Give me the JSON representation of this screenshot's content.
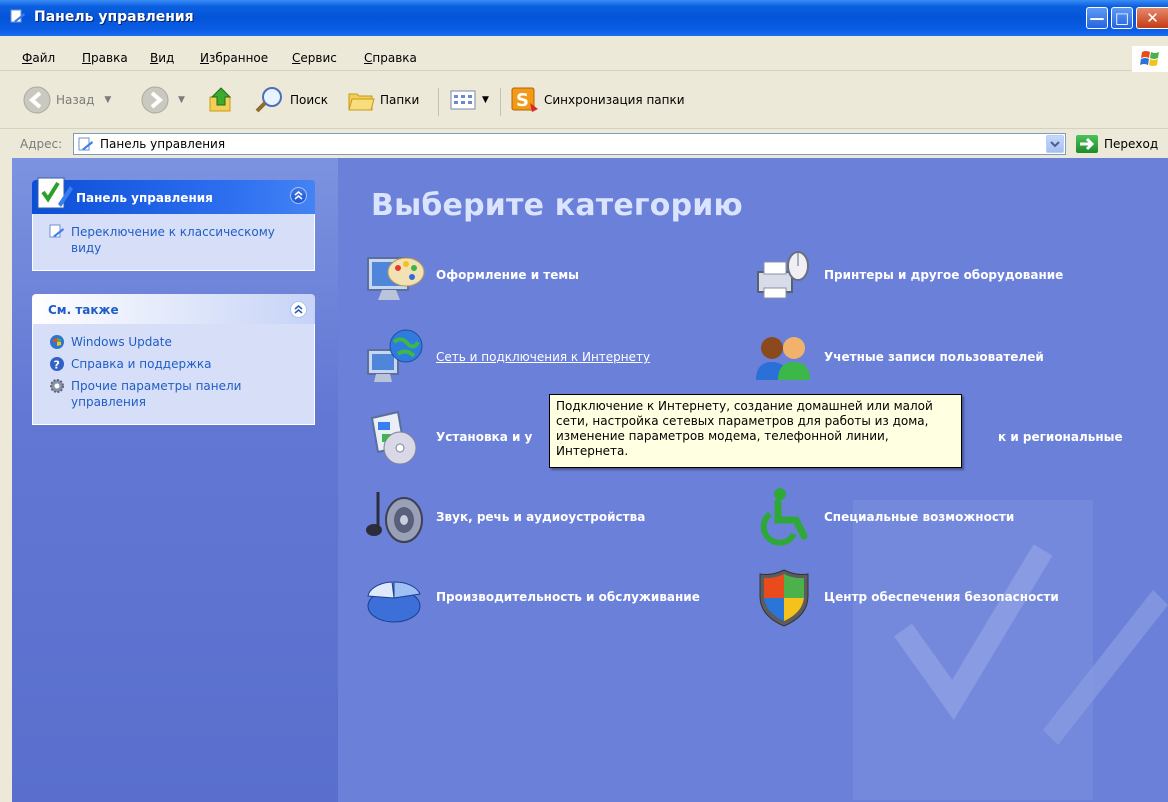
{
  "window": {
    "title": "Панель управления"
  },
  "menu": [
    "Файл",
    "Правка",
    "Вид",
    "Избранное",
    "Сервис",
    "Справка"
  ],
  "toolbar": {
    "back_label": "Назад",
    "search_label": "Поиск",
    "folders_label": "Папки",
    "sync_label": "Синхронизация папки"
  },
  "address": {
    "label": "Адрес:",
    "value": "Панель управления",
    "go_label": "Переход"
  },
  "left_panel": {
    "control_panel": {
      "title": "Панель управления",
      "items": [
        {
          "label": "Переключение к классическому виду",
          "icon": "control-panel-icon"
        }
      ]
    },
    "see_also": {
      "title": "См. также",
      "items": [
        {
          "label": "Windows Update",
          "icon": "windows-update-icon"
        },
        {
          "label": "Справка и поддержка",
          "icon": "help-icon"
        },
        {
          "label": "Прочие параметры панели управления",
          "icon": "settings-icon"
        }
      ]
    }
  },
  "main": {
    "heading": "Выберите категорию",
    "categories": [
      {
        "label": "Оформление и темы",
        "icon": "appearance-themes-icon"
      },
      {
        "label": "Принтеры и другое оборудование",
        "icon": "printers-hardware-icon"
      },
      {
        "label": "Сеть и подключения к Интернету",
        "icon": "network-internet-icon"
      },
      {
        "label": "Учетные записи пользователей",
        "icon": "user-accounts-icon"
      },
      {
        "label": "Установка и у",
        "icon": "add-remove-programs-icon"
      },
      {
        "label": "к и региональные",
        "icon": "regional-options-icon"
      },
      {
        "label": "Звук, речь и аудиоустройства",
        "icon": "sounds-speech-icon"
      },
      {
        "label": "Специальные возможности",
        "icon": "accessibility-icon"
      },
      {
        "label": "Производительность и обслуживание",
        "icon": "performance-maintenance-icon"
      },
      {
        "label": "Центр обеспечения безопасности",
        "icon": "security-center-icon"
      }
    ],
    "tooltip": "Подключение к Интернету, создание домашней или малой сети, настройка сетевых параметров для работы из дома, изменение параметров модема, телефонной линии, Интернета."
  },
  "colors": {
    "title_bar": "#0454d7",
    "content_bg": "#6b81d9",
    "tooltip_bg": "#ffffe1"
  }
}
